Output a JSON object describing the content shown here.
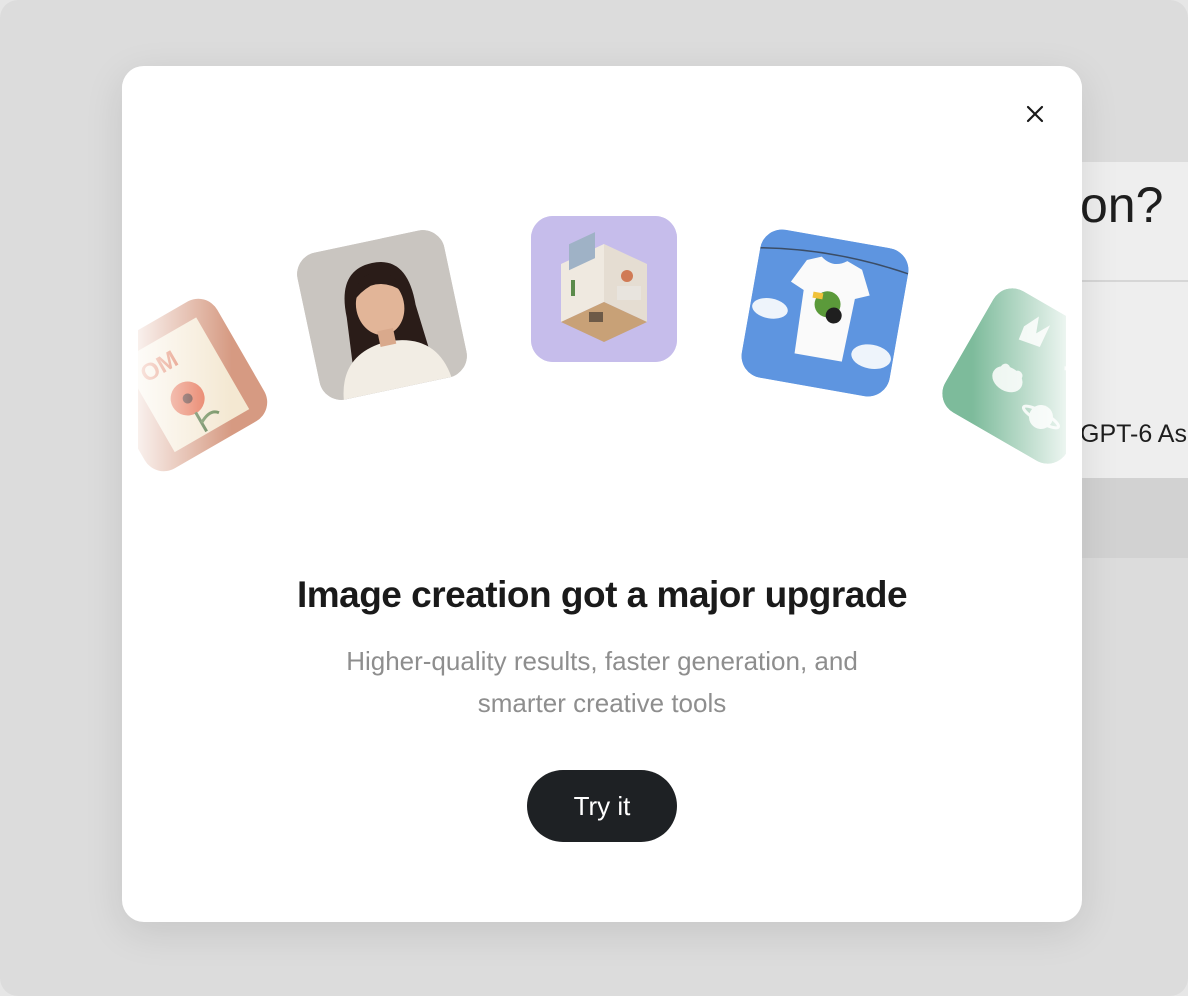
{
  "background": {
    "heading_fragment": "on?",
    "label_fragment": "GPT-6 As"
  },
  "modal": {
    "close_icon": "close-icon",
    "gallery_tiles": [
      {
        "name": "poster-tile",
        "subject": "poppy poster"
      },
      {
        "name": "portrait-tile",
        "subject": "portrait photo"
      },
      {
        "name": "room-tile",
        "subject": "isometric room"
      },
      {
        "name": "tshirt-tile",
        "subject": "t-shirt on clothesline"
      },
      {
        "name": "stickers-tile",
        "subject": "sticker sheet"
      }
    ],
    "headline": "Image creation got a major upgrade",
    "subtitle": "Higher-quality results, faster generation, and smarter creative tools",
    "cta_label": "Try it"
  },
  "colors": {
    "cta_bg": "#1e2124",
    "headline": "#1a1a1a",
    "subtitle": "#8e8e8e"
  }
}
